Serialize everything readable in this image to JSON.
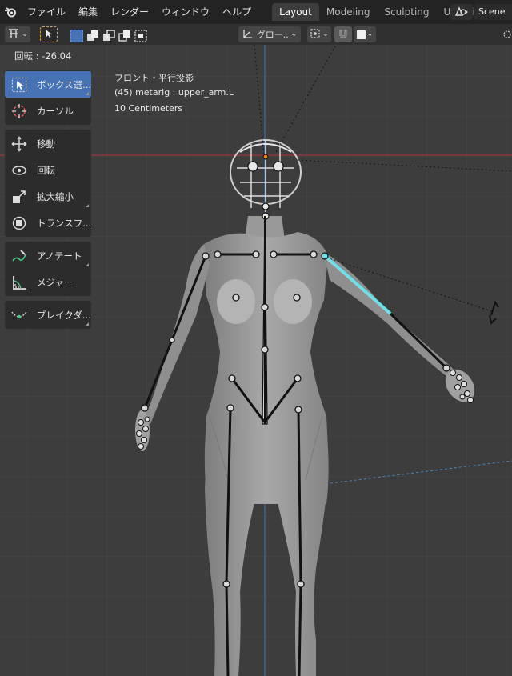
{
  "topbar": {
    "menu": [
      "ファイル",
      "編集",
      "レンダー",
      "ウィンドウ",
      "ヘルプ"
    ],
    "workspace_tabs": [
      "Layout",
      "Modeling",
      "Sculpting",
      "UV Editi"
    ],
    "active_tab": "Layout",
    "scene_name": "Scene"
  },
  "header": {
    "transform_orientation": "グロー..",
    "dropdown_glyph": "⌄"
  },
  "viewport": {
    "rotation_readout": "回転 : -26.04",
    "view_name": "フロント・平行投影",
    "object_info": "(45) metarig : upper_arm.L",
    "grid_scale": "10 Centimeters"
  },
  "toolbar": {
    "groups": [
      [
        {
          "name": "select-box",
          "label": "ボックス選...",
          "icon": "cursor-select-icon",
          "active": true
        },
        {
          "name": "cursor",
          "label": "カーソル",
          "icon": "cursor-target-icon",
          "active": false
        }
      ],
      [
        {
          "name": "move",
          "label": "移動",
          "icon": "move-arrows-icon",
          "active": false
        },
        {
          "name": "rotate",
          "label": "回転",
          "icon": "rotate-icon",
          "active": false
        },
        {
          "name": "scale",
          "label": "拡大縮小",
          "icon": "scale-icon",
          "active": false
        },
        {
          "name": "transform",
          "label": "トランスフ...",
          "icon": "transform-icon",
          "active": false
        }
      ],
      [
        {
          "name": "annotate",
          "label": "アノテート",
          "icon": "annotate-pen-icon",
          "active": false
        },
        {
          "name": "measure",
          "label": "メジャー",
          "icon": "ruler-icon",
          "active": false
        }
      ],
      [
        {
          "name": "bone-breakdown",
          "label": "ブレイクダ...",
          "icon": "breakdown-curve-icon",
          "active": false
        }
      ]
    ]
  },
  "colors": {
    "topbar_bg": "#232323",
    "header_bg": "#303030",
    "viewport_bg": "#3d3d3d",
    "active_tool": "#4772b3",
    "selected_bone": "#6fe0e8",
    "x_axis": "#9a3838",
    "z_axis": "#3d6fa8"
  }
}
